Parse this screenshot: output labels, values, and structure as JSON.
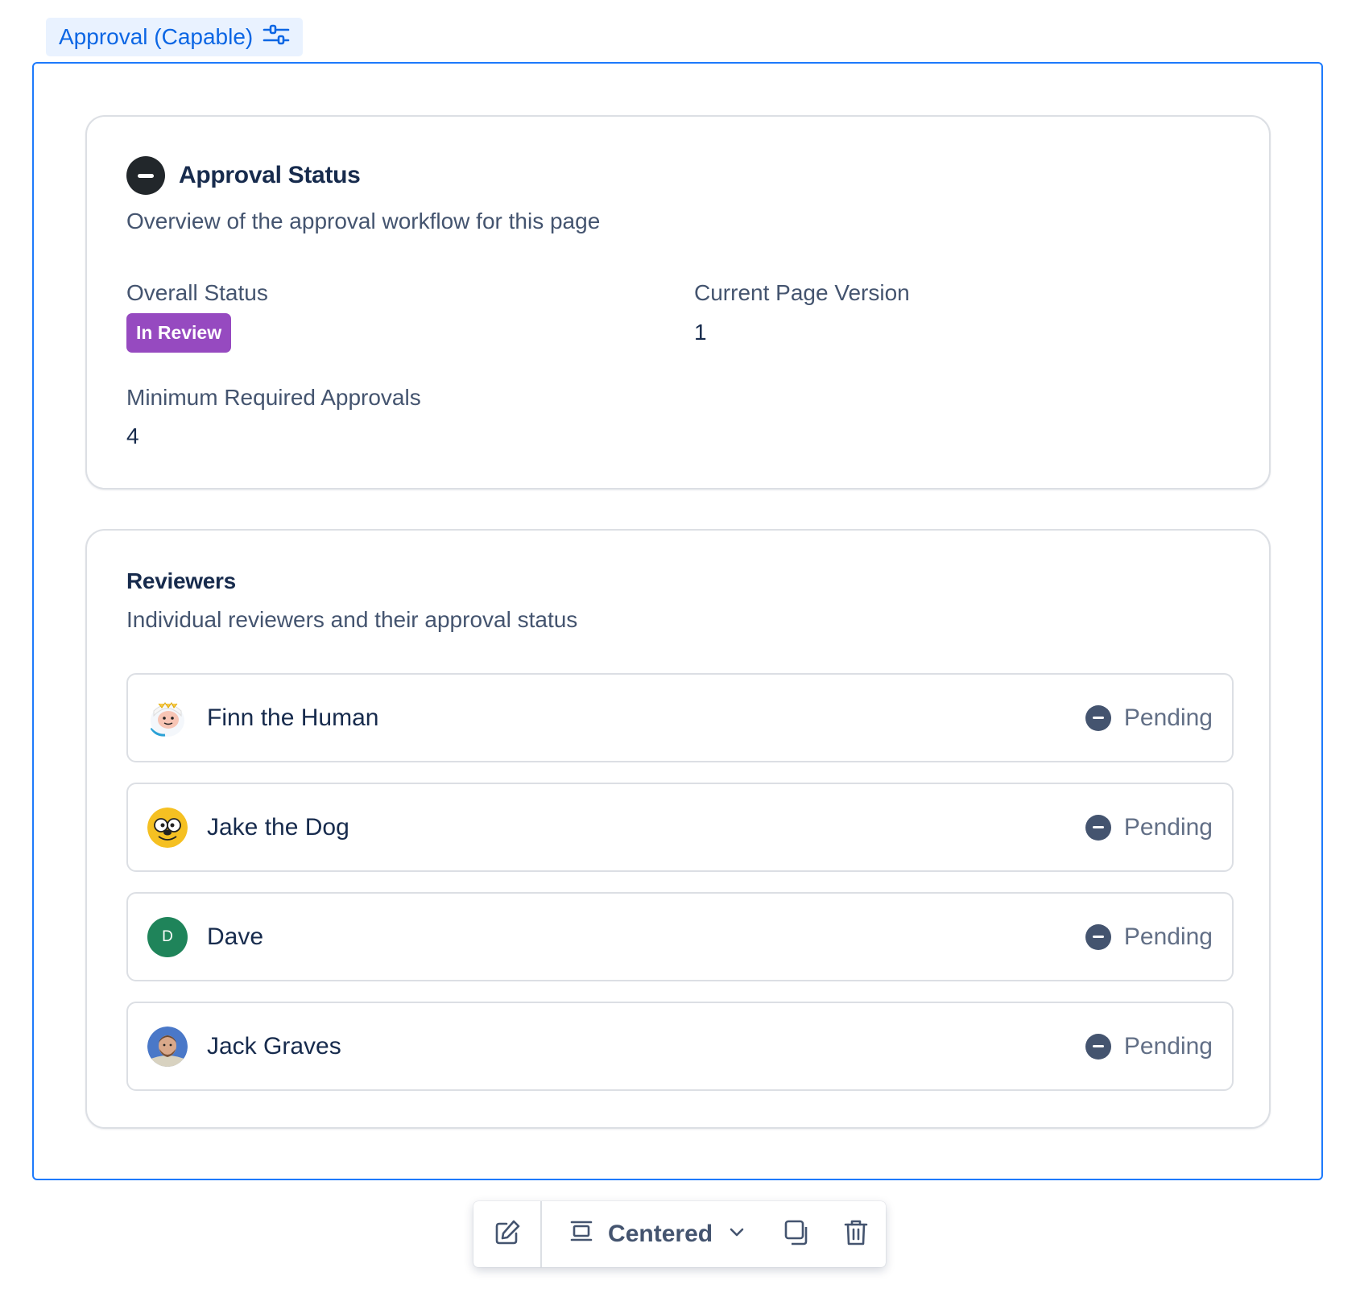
{
  "macro": {
    "tag_label": "Approval (Capable)",
    "tag_icon": "settings-sliders-icon"
  },
  "status_card": {
    "title": "Approval Status",
    "description": "Overview of the approval workflow for this page",
    "overall_status_label": "Overall Status",
    "overall_status_value": "In Review",
    "overall_status_color": "#964ac0",
    "page_version_label": "Current Page Version",
    "page_version_value": "1",
    "min_approvals_label": "Minimum Required Approvals",
    "min_approvals_value": "4"
  },
  "reviewers_card": {
    "title": "Reviewers",
    "description": "Individual reviewers and their approval status",
    "reviewers": [
      {
        "name": "Finn the Human",
        "status": "Pending",
        "avatar": "finn-avatar"
      },
      {
        "name": "Jake the Dog",
        "status": "Pending",
        "avatar": "jake-avatar"
      },
      {
        "name": "Dave",
        "status": "Pending",
        "avatar": "initial-avatar",
        "initial": "D",
        "avatar_color": "#1f845a"
      },
      {
        "name": "Jack Graves",
        "status": "Pending",
        "avatar": "photo-avatar"
      }
    ]
  },
  "toolbar": {
    "layout_label": "Centered",
    "icons": [
      "edit-icon",
      "layout-center-icon",
      "chevron-down-icon",
      "copy-icon",
      "trash-icon"
    ]
  },
  "colors": {
    "accent": "#1d7afc",
    "tag_background": "#e9f2ff",
    "badge": "#964ac0"
  }
}
